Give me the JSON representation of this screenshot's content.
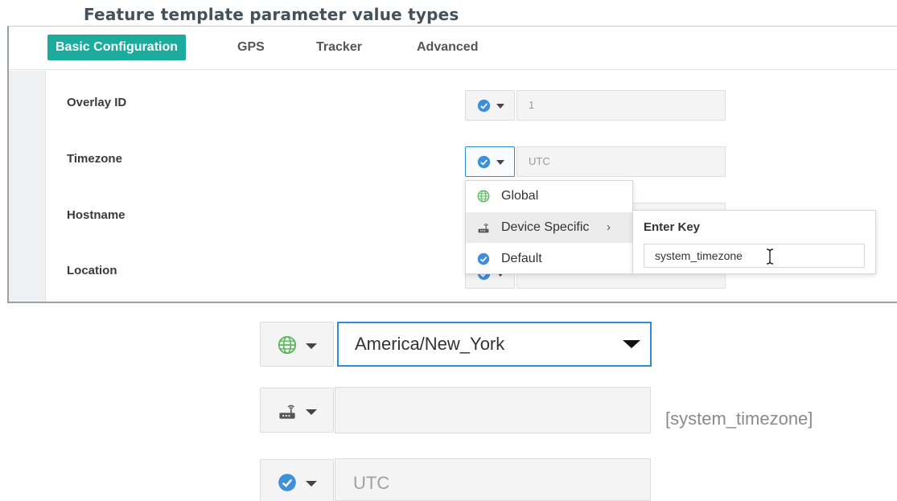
{
  "heading": "Feature template parameter value types",
  "tabs": [
    {
      "label": "Basic Configuration",
      "active": true
    },
    {
      "label": "GPS",
      "active": false
    },
    {
      "label": "Tracker",
      "active": false
    },
    {
      "label": "Advanced",
      "active": false
    }
  ],
  "rows": {
    "overlay_id": {
      "label": "Overlay ID",
      "value": "1",
      "type_icon": "check-circle-icon"
    },
    "timezone": {
      "label": "Timezone",
      "value": "UTC",
      "type_icon": "check-circle-icon"
    },
    "hostname": {
      "label": "Hostname"
    },
    "location": {
      "label": "Location",
      "type_icon": "check-circle-icon"
    }
  },
  "type_menu": {
    "items": [
      {
        "label": "Global",
        "icon": "globe-icon"
      },
      {
        "label": "Device Specific",
        "icon": "router-icon",
        "submenu_chevron": "›"
      },
      {
        "label": "Default",
        "icon": "check-circle-icon"
      }
    ]
  },
  "enter_key": {
    "title": "Enter Key",
    "value": "system_timezone"
  },
  "examples": {
    "global": {
      "icon": "globe-icon",
      "value": "America/New_York"
    },
    "device_specific": {
      "icon": "router-icon",
      "value": "",
      "variable": "[system_timezone]"
    },
    "default": {
      "icon": "check-circle-icon",
      "value": "UTC"
    }
  },
  "colors": {
    "accent_teal": "#1bac9e",
    "focus_blue": "#2a8fd6",
    "check_blue": "#3d8fd9",
    "globe_green": "#5cb85c"
  }
}
